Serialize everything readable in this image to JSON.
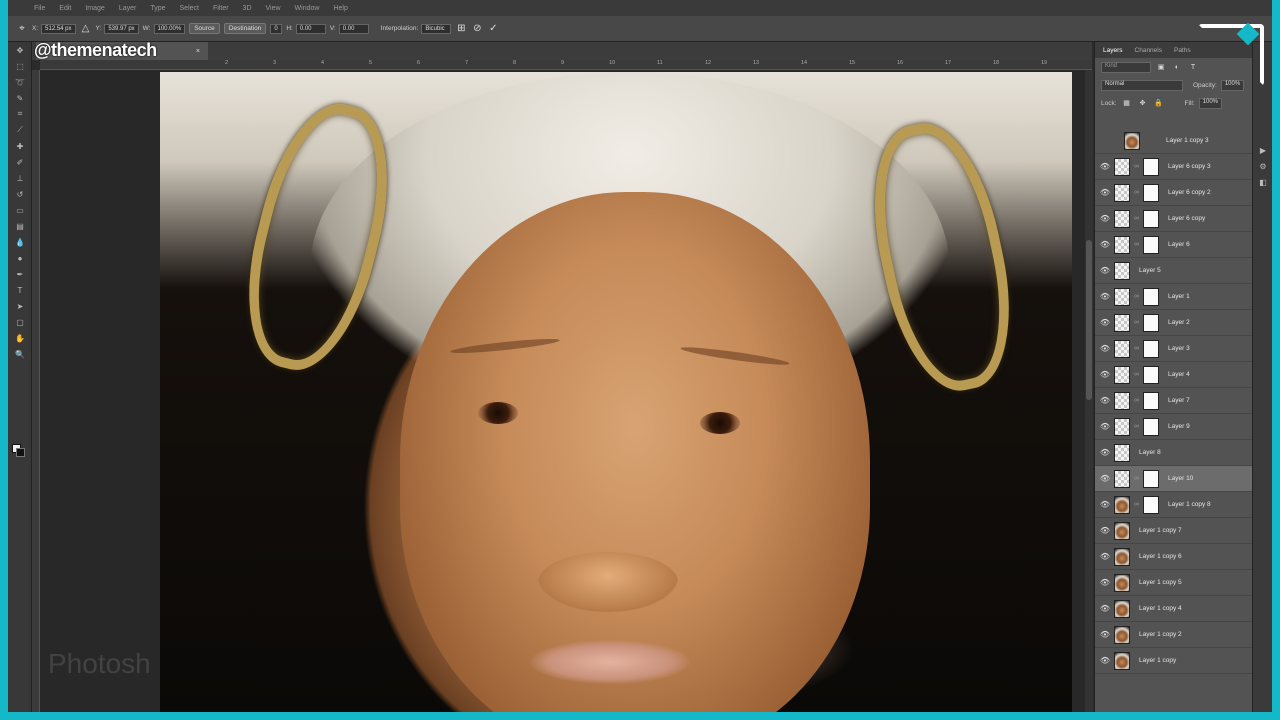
{
  "menubar": {
    "items": [
      "File",
      "Edit",
      "Image",
      "Layer",
      "Type",
      "Select",
      "Filter",
      "3D",
      "View",
      "Window",
      "Help"
    ]
  },
  "options": {
    "x_label": "X:",
    "x_value": "512.54 px",
    "y_label": "Y:",
    "y_value": "539.97 px",
    "w_label": "W:",
    "w_value": "100.00%",
    "source_label": "Source",
    "destination_label": "Destination",
    "offset_value": "0",
    "h_label": "H:",
    "h_value": "0.00",
    "v_label": "V:",
    "v_value": "0.00",
    "interpolation_label": "Interpolation:",
    "interpolation_value": "Bicubic"
  },
  "watermark": "@themenatech",
  "ruler": {
    "ticks": [
      "2",
      "3",
      "4",
      "5",
      "6",
      "7",
      "8",
      "9",
      "10",
      "11",
      "12",
      "13",
      "14",
      "15",
      "16",
      "17",
      "18",
      "19"
    ]
  },
  "canvas": {
    "photoshop_watermark": "Photosh"
  },
  "layers_panel": {
    "tabs": [
      "Layers",
      "Channels",
      "Paths"
    ],
    "kind_placeholder": "Kind",
    "blend_mode": "Normal",
    "opacity_label": "Opacity:",
    "opacity_value": "100%",
    "lock_label": "Lock:",
    "fill_label": "Fill:",
    "fill_value": "100%",
    "layers": [
      {
        "name": "Layer 1 copy 3",
        "thumb": "photo",
        "mask": false,
        "visible": false
      },
      {
        "name": "Layer 6 copy 3",
        "thumb": "checker",
        "mask": true,
        "visible": true
      },
      {
        "name": "Layer 6 copy 2",
        "thumb": "checker",
        "mask": true,
        "visible": true
      },
      {
        "name": "Layer 6 copy",
        "thumb": "checker",
        "mask": true,
        "visible": true
      },
      {
        "name": "Layer 6",
        "thumb": "checker",
        "mask": true,
        "visible": true
      },
      {
        "name": "Layer 5",
        "thumb": "checker",
        "mask": false,
        "visible": true
      },
      {
        "name": "Layer 1",
        "thumb": "checker",
        "mask": true,
        "visible": true
      },
      {
        "name": "Layer 2",
        "thumb": "checker",
        "mask": true,
        "visible": true
      },
      {
        "name": "Layer 3",
        "thumb": "checker",
        "mask": true,
        "visible": true
      },
      {
        "name": "Layer 4",
        "thumb": "checker",
        "mask": true,
        "visible": true
      },
      {
        "name": "Layer 7",
        "thumb": "checker",
        "mask": true,
        "visible": true
      },
      {
        "name": "Layer 9",
        "thumb": "checker",
        "mask": true,
        "visible": true
      },
      {
        "name": "Layer 8",
        "thumb": "checker",
        "mask": false,
        "visible": true
      },
      {
        "name": "Layer 10",
        "thumb": "checker",
        "mask": true,
        "visible": true,
        "selected": true
      },
      {
        "name": "Layer 1 copy 8",
        "thumb": "photo",
        "mask": true,
        "visible": true
      },
      {
        "name": "Layer 1 copy 7",
        "thumb": "photo",
        "mask": false,
        "visible": true
      },
      {
        "name": "Layer 1 copy 6",
        "thumb": "photo",
        "mask": false,
        "visible": true
      },
      {
        "name": "Layer 1 copy 5",
        "thumb": "photo",
        "mask": false,
        "visible": true
      },
      {
        "name": "Layer 1 copy 4",
        "thumb": "photo",
        "mask": false,
        "visible": true
      },
      {
        "name": "Layer 1 copy 2",
        "thumb": "photo",
        "mask": false,
        "visible": true
      },
      {
        "name": "Layer 1 copy",
        "thumb": "photo",
        "mask": false,
        "visible": true
      }
    ]
  }
}
